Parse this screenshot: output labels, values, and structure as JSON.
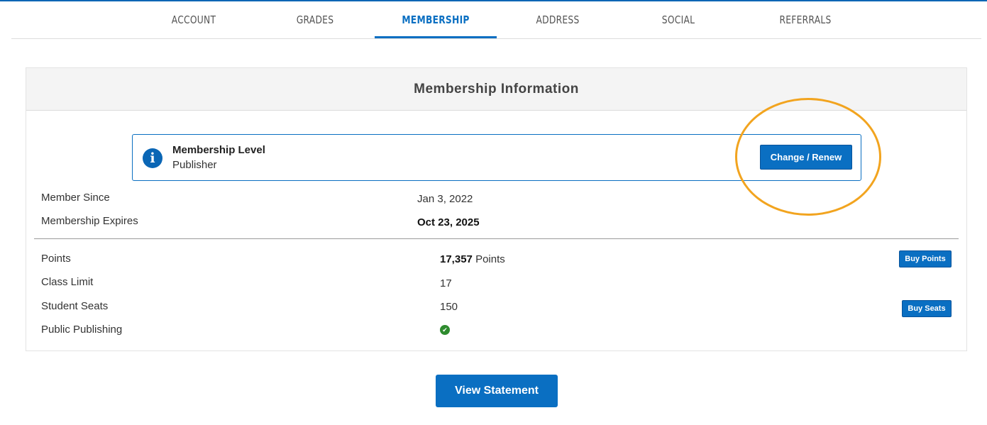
{
  "tabs": [
    {
      "label": "ACCOUNT"
    },
    {
      "label": "GRADES"
    },
    {
      "label": "MEMBERSHIP",
      "active": true
    },
    {
      "label": "ADDRESS"
    },
    {
      "label": "SOCIAL"
    },
    {
      "label": "REFERRALS"
    }
  ],
  "panel": {
    "title": "Membership Information"
  },
  "membership_level": {
    "title": "Membership Level",
    "value": "Publisher",
    "button_label": "Change / Renew"
  },
  "details": {
    "member_since_label": "Member Since",
    "member_since_value": "Jan 3, 2022",
    "expires_label": "Membership Expires",
    "expires_value": "Oct 23, 2025",
    "points_label": "Points",
    "points_value": "17,357",
    "points_unit": "Points",
    "buy_points_label": "Buy Points",
    "class_limit_label": "Class Limit",
    "class_limit_value": "17",
    "student_seats_label": "Student Seats",
    "student_seats_value": "150",
    "buy_seats_label": "Buy Seats",
    "public_publishing_label": "Public Publishing",
    "public_publishing_enabled": true
  },
  "footer": {
    "view_statement_label": "View Statement"
  },
  "icons": {
    "info": "info-icon",
    "check": "check-circle-icon"
  },
  "colors": {
    "accent": "#0a6fc2",
    "highlight": "#f2a41f",
    "success": "#2e8b2e"
  }
}
